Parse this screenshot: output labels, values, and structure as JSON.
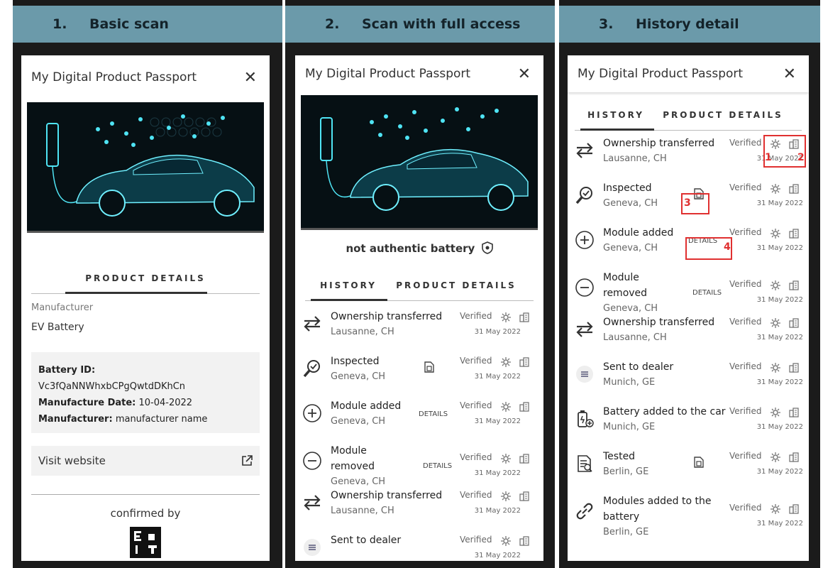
{
  "panels": [
    {
      "number": "1.",
      "title": "Basic scan"
    },
    {
      "number": "2.",
      "title": "Scan with full access"
    },
    {
      "number": "3.",
      "title": "History detail"
    }
  ],
  "app_title": "My Digital Product Passport",
  "close_glyph": "✕",
  "tabs": {
    "history": "HISTORY",
    "product_details": "PRODUCT DETAILS"
  },
  "basic": {
    "manufacturer_label": "Manufacturer",
    "manufacturer_value": "EV Battery",
    "battery_id_label": "Battery ID:",
    "battery_id_value": "Vc3fQaNNWhxbCPgQwtdDKhCn",
    "manufacture_date_label": "Manufacture Date:",
    "manufacture_date_value": "10-04-2022",
    "manufacturer2_label": "Manufacturer:",
    "manufacturer2_value": "manufacturer name",
    "visit_website": "Visit website",
    "confirmed_by": "confirmed by"
  },
  "auth_status": "not authentic battery",
  "verified": "Verified",
  "details": "DETAILS",
  "date": "31 May 2022",
  "events2": [
    {
      "t1": "Ownership transferred",
      "loc": "Lausanne, CH",
      "icon": "arrows"
    },
    {
      "t1": "Inspected",
      "loc": "Geneva, CH",
      "icon": "magnifier"
    },
    {
      "t1": "Module added",
      "loc": "Geneva, CH",
      "icon": "plus"
    },
    {
      "t1": "Module",
      "t2": "removed",
      "loc": "Geneva, CH",
      "icon": "minus"
    },
    {
      "t1": "Ownership transferred",
      "loc": "Lausanne, CH",
      "icon": "arrows"
    },
    {
      "t1": "Sent to dealer",
      "loc": "",
      "icon": "list"
    }
  ],
  "events3": [
    {
      "t1": "Ownership transferred",
      "loc": "Lausanne, CH",
      "icon": "arrows"
    },
    {
      "t1": "Inspected",
      "loc": "Geneva, CH",
      "icon": "magnifier"
    },
    {
      "t1": "Module added",
      "loc": "Geneva, CH",
      "icon": "plus"
    },
    {
      "t1": "Module",
      "t2": "removed",
      "loc": "Geneva, CH",
      "icon": "minus"
    },
    {
      "t1": "Ownership transferred",
      "loc": "Lausanne, CH",
      "icon": "arrows"
    },
    {
      "t1": "Sent to dealer",
      "loc": "Munich, GE",
      "icon": "list"
    },
    {
      "t1": "Battery added to the car",
      "loc": "Munich, GE",
      "icon": "battery"
    },
    {
      "t1": "Tested",
      "loc": "Berlin, GE",
      "icon": "doc"
    },
    {
      "t1": "Modules added to the",
      "t2": "battery",
      "loc": "Berlin, GE",
      "icon": "link"
    }
  ],
  "annotations": [
    "1",
    "2",
    "3",
    "4"
  ],
  "colors": {
    "panel_header": "#6b9aaa",
    "annotation": "#e03030",
    "car_glow": "#46e0f0"
  }
}
